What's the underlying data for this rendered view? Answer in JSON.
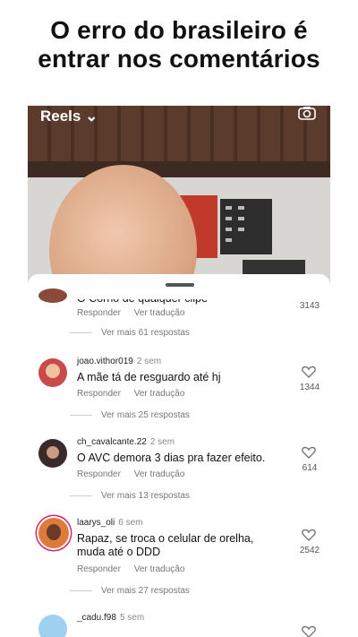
{
  "caption": {
    "line1": "O erro do brasileiro é",
    "line2": "entrar nos comentários"
  },
  "reel": {
    "header_label": "Reels ⌄",
    "camera_icon": "camera-icon"
  },
  "comments": [
    {
      "text": "O Corno de qualquer clipe",
      "reply": "Responder",
      "translate": "Ver tradução",
      "likes": "3143",
      "more_replies": "Ver mais 61 respostas"
    },
    {
      "user": "joao.vithor019",
      "time": "2 sem",
      "text": "A mãe tá de resguardo até hj",
      "reply": "Responder",
      "translate": "Ver tradução",
      "likes": "1344",
      "more_replies": "Ver mais 25 respostas"
    },
    {
      "user": "ch_cavalcante.22",
      "time": "2 sem",
      "text": "O AVC demora 3 dias pra fazer efeito.",
      "reply": "Responder",
      "translate": "Ver tradução",
      "likes": "614",
      "more_replies": "Ver mais 13 respostas"
    },
    {
      "user": "laarys_oli",
      "time": "6 sem",
      "text": "Rapaz, se troca o celular de orelha, muda até o DDD",
      "reply": "Responder",
      "translate": "Ver tradução",
      "likes": "2542",
      "more_replies": "Ver mais 27 respostas"
    },
    {
      "user": "_cadu.f98",
      "time": "5 sem"
    }
  ],
  "colors": {
    "avatar_1": "#8a4a3a",
    "avatar_2": "#c84a4a",
    "avatar_3": "#3a2a2a",
    "avatar_4": "#e07a3a",
    "avatar_5": "#9fd0ef"
  }
}
